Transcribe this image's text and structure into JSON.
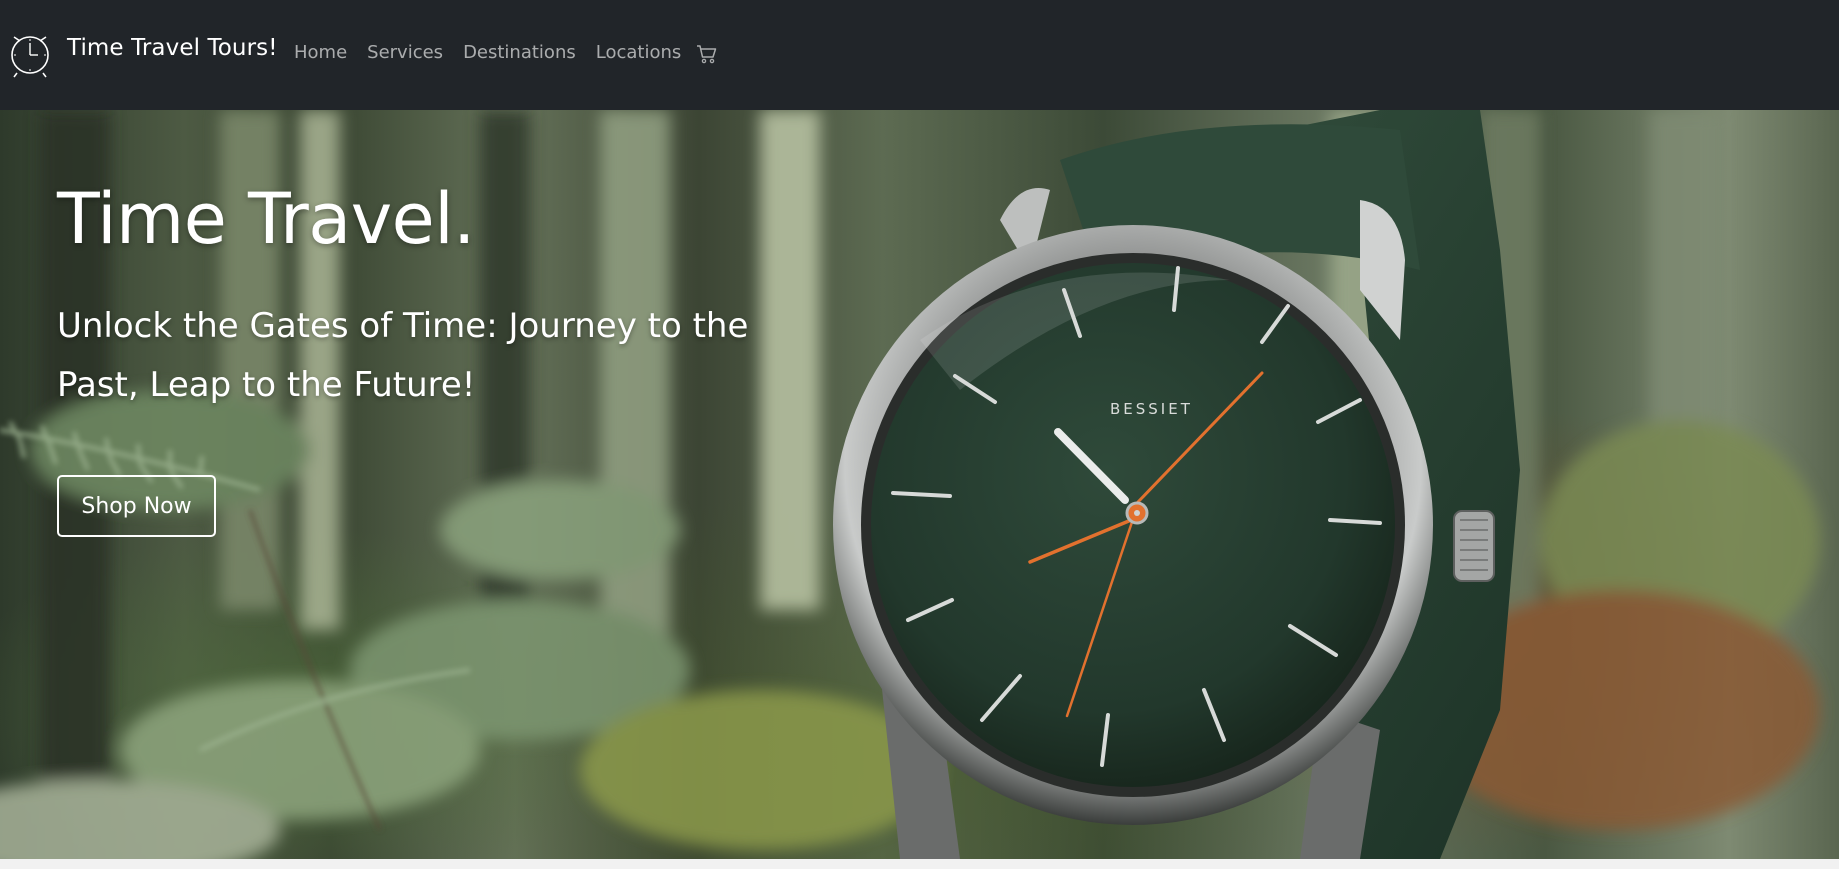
{
  "nav": {
    "brand": "Time Travel Tours!",
    "links": [
      {
        "label": "Home"
      },
      {
        "label": "Services"
      },
      {
        "label": "Destinations"
      },
      {
        "label": "Locations"
      }
    ]
  },
  "hero": {
    "title": "Time Travel.",
    "subtitle": "Unlock the Gates of Time: Journey to the Past, Leap to the Future!",
    "cta_label": "Shop Now",
    "watch_dial_text": "BESSIET"
  },
  "icons": {
    "brand": "alarm-clock-icon",
    "cart": "cart-icon"
  },
  "colors": {
    "navbar_bg": "#212529",
    "watch_dial": "#22382c",
    "watch_hands_accent": "#e2712e"
  }
}
